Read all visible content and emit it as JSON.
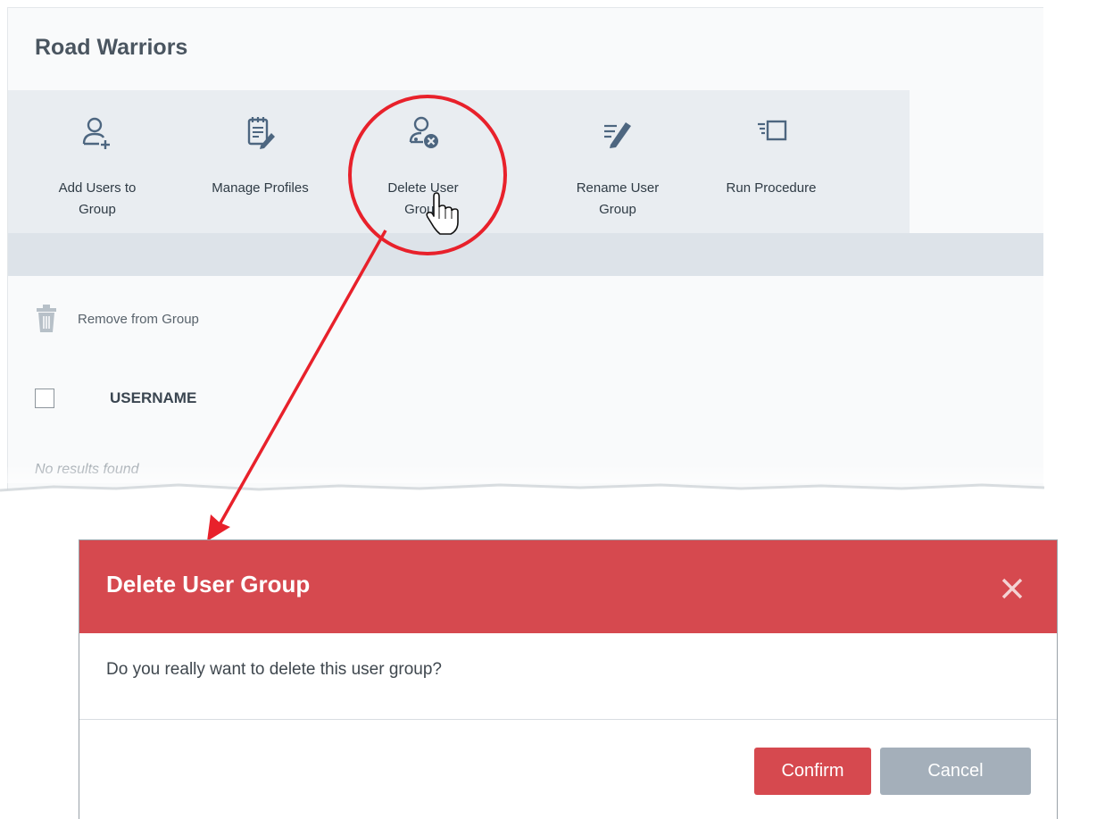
{
  "page": {
    "title": "Road Warriors"
  },
  "toolbar": {
    "items": [
      {
        "label": "Add Users to\nGroup",
        "icon": "add-user-icon"
      },
      {
        "label": "Manage Profiles",
        "icon": "manage-profiles-icon"
      },
      {
        "label": "Delete User\nGroup",
        "icon": "delete-user-group-icon"
      },
      {
        "label": "Rename User\nGroup",
        "icon": "rename-icon"
      },
      {
        "label": "Run Procedure",
        "icon": "run-procedure-icon"
      }
    ]
  },
  "actions": {
    "remove_label": "Remove from Group",
    "remove_icon": "trash-icon"
  },
  "table": {
    "columns": [
      "USERNAME"
    ],
    "empty_text": "No results found"
  },
  "dialog": {
    "title": "Delete User Group",
    "message": "Do you really want to delete this user group?",
    "confirm_label": "Confirm",
    "cancel_label": "Cancel",
    "close_icon": "close-icon"
  },
  "colors": {
    "danger": "#d6494f",
    "secondary": "#a4afba",
    "annotation": "#e8212b"
  }
}
